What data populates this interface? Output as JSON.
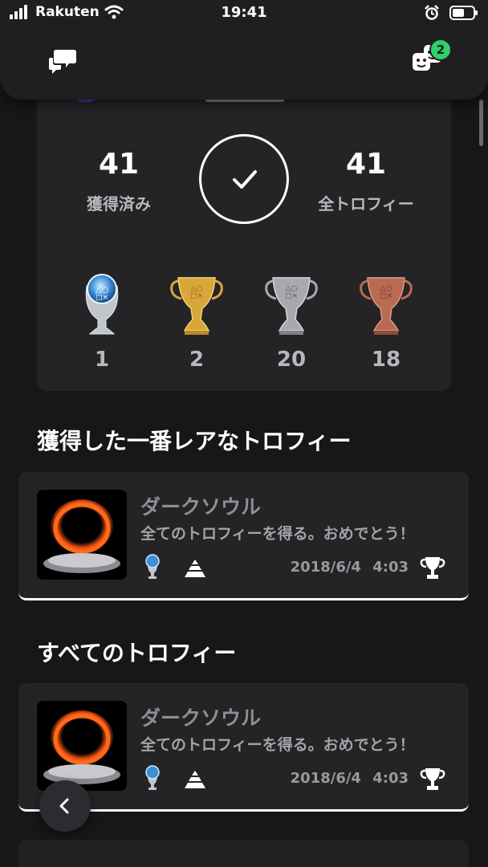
{
  "status_bar": {
    "carrier": "Rakuten",
    "time": "19:41"
  },
  "header": {
    "friends_badge": "2"
  },
  "summary": {
    "earned_count": "41",
    "earned_label": "獲得済み",
    "total_count": "41",
    "total_label": "全トロフィー",
    "trophies": [
      {
        "type": "platinum",
        "count": "1"
      },
      {
        "type": "gold",
        "count": "2"
      },
      {
        "type": "silver",
        "count": "20"
      },
      {
        "type": "bronze",
        "count": "18"
      }
    ]
  },
  "rarest_section": {
    "title": "獲得した一番レアなトロフィー",
    "card": {
      "title": "ダークソウル",
      "description": "全てのトロフィーを得る。おめでとう！",
      "date": "2018/6/4",
      "time": "4:03",
      "grade_icon": "platinum-trophy-icon",
      "rarity_icon": "ultra-rare-icon"
    }
  },
  "all_section": {
    "title": "すべてのトロフィー",
    "cards": [
      {
        "title": "ダークソウル",
        "description": "全てのトロフィーを得る。おめでとう！",
        "date": "2018/6/4",
        "time": "4:03",
        "grade_icon": "platinum-trophy-icon",
        "rarity_icon": "ultra-rare-icon"
      }
    ]
  },
  "colors": {
    "background": "#171719",
    "card": "#242427",
    "badge": "#2fd06c",
    "platinum": "#7ab8e8",
    "gold": "#d9a63a",
    "silver": "#a8a8ad",
    "bronze": "#b86a52"
  }
}
